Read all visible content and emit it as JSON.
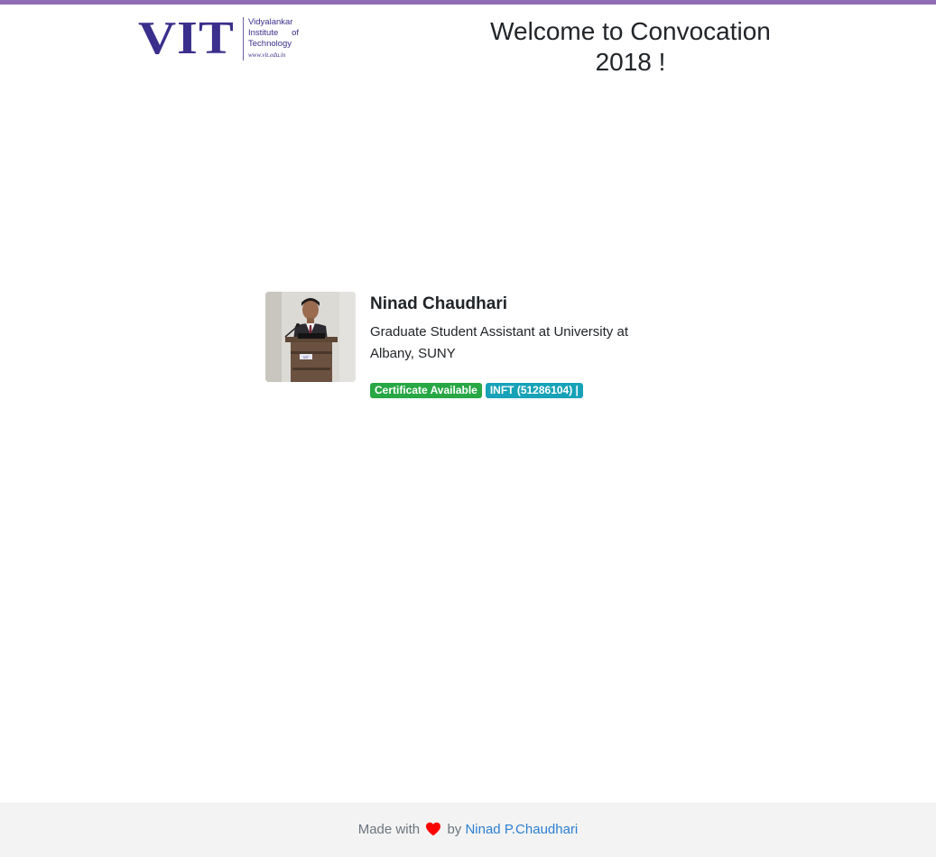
{
  "brand": {
    "logo_mark": "VIT",
    "logo_line1": "Vidyalankar",
    "logo_line2a": "Institute",
    "logo_line2b": "of",
    "logo_line3": "Technology",
    "logo_url": "www.vit.edu.in",
    "accent_color": "#8e6bb3"
  },
  "header": {
    "title_line1": "Welcome to Convocation",
    "title_line2": "2018 !"
  },
  "profile": {
    "photo_icon": "graduate-photo",
    "name": "Ninad Chaudhari",
    "role": "Graduate Student Assistant at University at Albany, SUNY",
    "badges": {
      "certificate": "Certificate Available",
      "department": "INFT (51286104) |"
    },
    "badge_colors": {
      "certificate": "#28a745",
      "department": "#17a2b8"
    }
  },
  "footer": {
    "made_with": "Made with",
    "heart_icon": "heart-icon",
    "by": "by",
    "author": "Ninad P.Chaudhari"
  }
}
